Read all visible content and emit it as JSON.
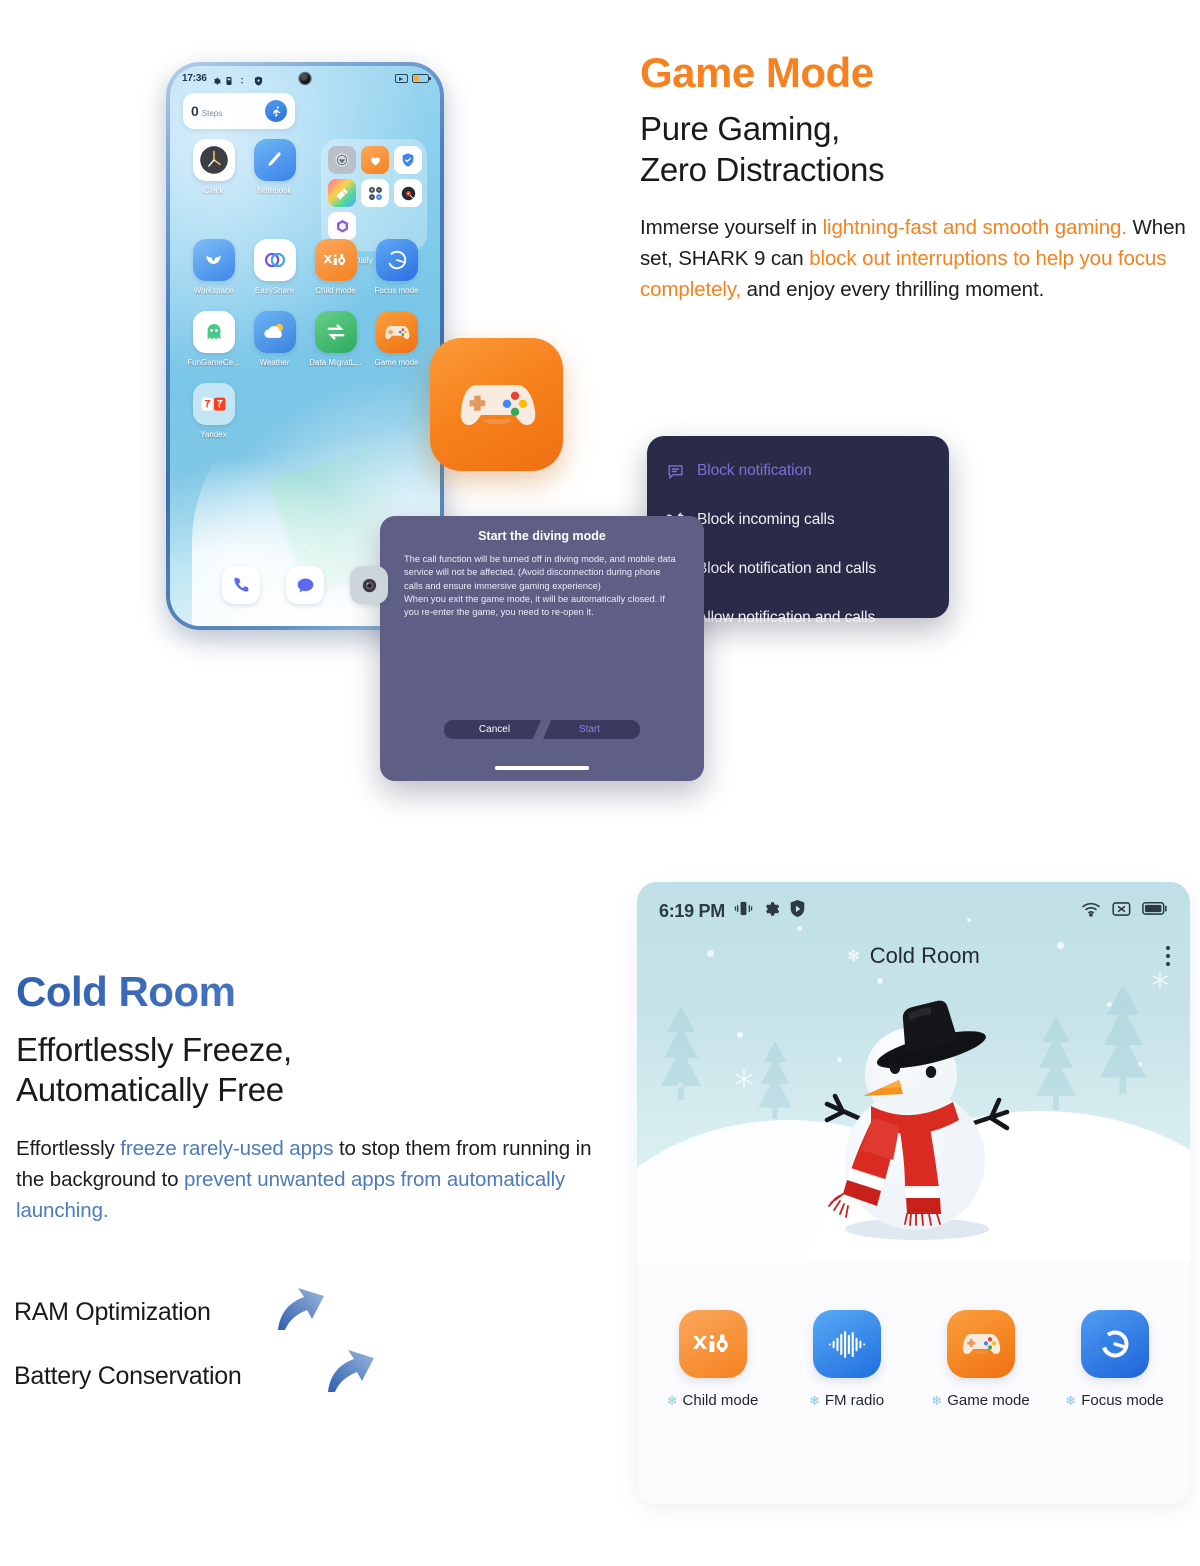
{
  "colors": {
    "orange": "#F5821F",
    "blue": "#4c7ac0",
    "panel_dark": "#2a2b48",
    "accent_purple": "#7c6fd6",
    "dialog": "#5f5f86"
  },
  "game_mode": {
    "heading": "Game Mode",
    "subheading_line1": "Pure Gaming,",
    "subheading_line2": "Zero Distractions",
    "body": [
      {
        "text": "Immerse yourself in ",
        "style": "normal"
      },
      {
        "text": "lightning-fast and smooth gaming.",
        "style": "orange"
      },
      {
        "text": " When set, SHARK 9 can ",
        "style": "normal"
      },
      {
        "text": "block out interruptions to help you focus completely,",
        "style": "orange"
      },
      {
        "text": " and enjoy every thrilling moment.",
        "style": "normal"
      }
    ]
  },
  "phone": {
    "status_bar": {
      "time": "17:36",
      "icons_left": [
        "gear-icon",
        "sim-icon",
        "shield-icon"
      ],
      "icons_right": [
        "cast-icon",
        "battery-icon"
      ]
    },
    "widget": {
      "value": "0",
      "label": "Steps",
      "icon": "runner-icon"
    },
    "folder": {
      "label": "Daily apps",
      "icon_count": 7
    },
    "apps_row_clock": [
      {
        "label": "Clock",
        "icon": "clock-icon"
      },
      {
        "label": "Notebook",
        "icon": "notebook-icon"
      }
    ],
    "apps_row2": [
      {
        "label": "Workspace",
        "icon": "workspace-icon"
      },
      {
        "label": "EasyShare",
        "icon": "easyshare-icon"
      },
      {
        "label": "Child mode",
        "icon": "kid-icon"
      },
      {
        "label": "Focus mode",
        "icon": "focus-icon"
      }
    ],
    "apps_row3": [
      {
        "label": "FunGameCe...",
        "icon": "fungamecenter-icon"
      },
      {
        "label": "Weather",
        "icon": "weather-icon"
      },
      {
        "label": "Data MigratL...",
        "icon": "data-migration-icon"
      },
      {
        "label": "Game mode",
        "icon": "gamepad-icon"
      }
    ],
    "apps_row4": [
      {
        "label": "Yandex",
        "icon": "yandex-icon"
      }
    ],
    "dock": [
      {
        "label": "Phone",
        "icon": "phone-icon"
      },
      {
        "label": "Messages",
        "icon": "message-icon"
      },
      {
        "label": "Camera",
        "icon": "camera-icon"
      }
    ]
  },
  "notification_menu": {
    "items": [
      {
        "label": "Block notification",
        "icon": "chat-bubble-icon",
        "active": true
      },
      {
        "label": "Block incoming calls",
        "icon": "call-block-icon",
        "active": false
      },
      {
        "label": "Block notification and calls",
        "icon": "no-entry-icon",
        "active": false
      },
      {
        "label": "Allow notification and calls",
        "icon": "call-chat-icon",
        "active": false
      }
    ]
  },
  "diving_dialog": {
    "title": "Start the diving mode",
    "body": "The call function will be turned off in diving mode, and mobile data service will not be affected. (Avoid disconnection during phone calls and ensure immersive gaming experience)\nWhen you exit the game mode, it will be automatically closed. If you re-enter the game, you need to re-open it.",
    "cancel_label": "Cancel",
    "start_label": "Start"
  },
  "cold_room": {
    "heading": "Cold Room",
    "subheading_line1": "Effortlessly Freeze,",
    "subheading_line2": "Automatically Free",
    "body": [
      {
        "text": "Effortlessly ",
        "style": "normal"
      },
      {
        "text": "freeze rarely-used apps",
        "style": "blue"
      },
      {
        "text": " to stop them from running in the background to ",
        "style": "normal"
      },
      {
        "text": "prevent unwanted apps from automatically launching.",
        "style": "blue"
      }
    ],
    "features": [
      "RAM Optimization",
      "Battery Conservation"
    ]
  },
  "cold_room_app": {
    "status_bar": {
      "time": "6:19 PM",
      "icons_left": [
        "vibrate-icon",
        "gear-icon",
        "shield-play-icon"
      ],
      "icons_right": [
        "wifi-icon",
        "no-sim-icon",
        "battery-icon"
      ]
    },
    "title": "Cold Room",
    "title_icon": "snowflake-icon",
    "menu_icon": "kebab-menu-icon",
    "illustration": "snowman-illustration",
    "apps": [
      {
        "label": "Child mode",
        "icon": "kid-icon"
      },
      {
        "label": "FM radio",
        "icon": "fm-radio-icon"
      },
      {
        "label": "Game mode",
        "icon": "gamepad-icon"
      },
      {
        "label": "Focus mode",
        "icon": "focus-icon"
      }
    ]
  }
}
